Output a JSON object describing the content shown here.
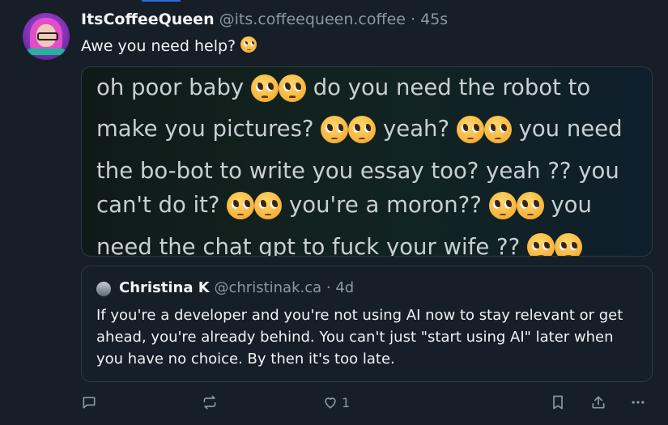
{
  "post": {
    "display_name": "ItsCoffeeQueen",
    "handle": "@its.coffeequeen.coffee",
    "separator": "·",
    "time": "45s",
    "text": "Awe you need help?",
    "emoji": "pleading-face"
  },
  "image_text": {
    "line1": "oh poor baby",
    "line1b": "do you need the robot to",
    "line2": "make you pictures?",
    "line2b": "yeah?",
    "line2c": "you need",
    "line3": "the bo-bot to write you essay too? yeah ?? you",
    "line4": "can't do it?",
    "line4b": "you're a moron??",
    "line4c": "you",
    "line5": "need the chat gpt to fuck your wife ??"
  },
  "quote": {
    "display_name": "Christina K",
    "handle": "@christinak.ca",
    "separator": "·",
    "time": "4d",
    "text": "If you're a developer and you're not using AI now to stay relevant or get ahead, you're already behind. You can't just \"start using AI\" later when you have no choice. By then it's too late."
  },
  "actions": {
    "like_count": "1"
  },
  "icons": {
    "reply": "reply-icon",
    "repost": "repost-icon",
    "like": "heart-icon",
    "bookmark": "bookmark-icon",
    "share": "share-icon",
    "more": "more-icon"
  },
  "colors": {
    "background": "#161e27",
    "muted": "#8b98a5",
    "text": "#f1f3f5",
    "accent": "#2a6fd6"
  }
}
